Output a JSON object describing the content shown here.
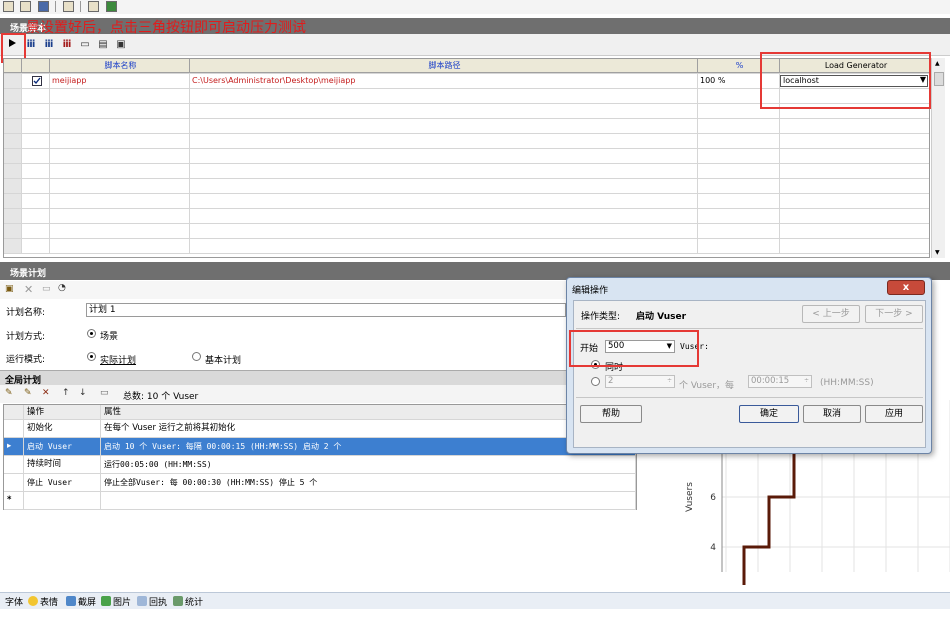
{
  "annotation": {
    "top_text": "景设置好后，点击三角按钮即可启动压力测试"
  },
  "script_panel": {
    "title": "场景脚本",
    "columns": [
      "脚本名称",
      "脚本路径",
      "%",
      "Load Generator"
    ],
    "rows": [
      {
        "checked": true,
        "name": "meijiapp",
        "path": "C:\\Users\\Administrator\\Desktop\\meijiapp",
        "percent": "100 %",
        "load_generator": "localhost"
      }
    ],
    "empty_rows": 11
  },
  "plan_panel": {
    "title": "场景计划",
    "plan_name_label": "计划名称:",
    "plan_name_value": "计划 1",
    "plan_mode_label": "计划方式:",
    "plan_mode_option": "场景",
    "run_mode_label": "运行模式:",
    "run_mode_options": [
      "实际计划",
      "基本计划"
    ]
  },
  "global_plan": {
    "title": "全局计划",
    "total_text": "总数: 10 个 Vuser",
    "headers": [
      "操作",
      "属性"
    ],
    "rows": [
      {
        "action": "初始化",
        "property": "在每个 Vuser 运行之前将其初始化",
        "selected": false
      },
      {
        "action": "启动 Vuser",
        "property": "启动 10 个 Vuser: 每隔 00:00:15 (HH:MM:SS) 启动 2 个",
        "selected": true
      },
      {
        "action": "持续时间",
        "property": "运行00:05:00 (HH:MM:SS)",
        "selected": false
      },
      {
        "action": "停止 Vuser",
        "property": "停止全部Vuser: 每 00:00:30 (HH:MM:SS) 停止 5 个",
        "selected": false
      }
    ],
    "new_row_marker": "*"
  },
  "chart_data": {
    "type": "line",
    "ylabel": "Vusers",
    "y_ticks": [
      4,
      6
    ],
    "series": [
      {
        "x": [
          0,
          0,
          1,
          1,
          2,
          2,
          3,
          3
        ],
        "y": [
          2,
          4,
          4,
          6,
          6,
          8,
          8,
          10
        ]
      }
    ],
    "line_color": "#5a1a08"
  },
  "dialog": {
    "title": "编辑操作",
    "close": "x",
    "op_type_label": "操作类型:",
    "op_type_value": "启动 Vuser",
    "prev_button": "< 上一步",
    "next_button": "下一步 >",
    "start_label": "开始",
    "start_value": "500",
    "vuser_label": "Vuser:",
    "simultaneous_label": "同时",
    "batch_count": "2",
    "batch_text": "个 Vuser，每",
    "batch_interval": "00:00:15",
    "time_format": "(HH:MM:SS)",
    "help_button": "帮助",
    "ok_button": "确定",
    "cancel_button": "取消",
    "apply_button": "应用"
  },
  "bottom_bar": {
    "items": [
      "字体",
      "表情",
      "截屏",
      "图片",
      "回执",
      "统计"
    ]
  }
}
